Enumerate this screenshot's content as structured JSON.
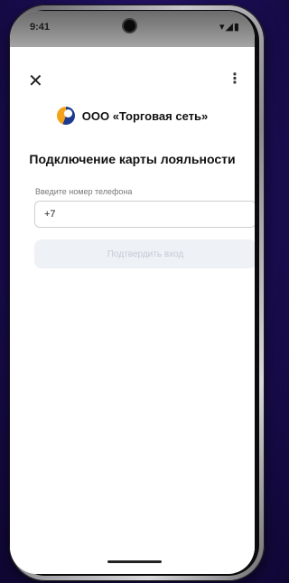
{
  "status_bar": {
    "time": "9:41",
    "icons": "▾◢▮"
  },
  "header": {
    "close_icon": "✕",
    "more_icon": "⋮"
  },
  "brand": {
    "name": "ООО «Торговая сеть»",
    "logo_colors": [
      "#1d3a8f",
      "#f3a21b"
    ]
  },
  "title": "Подключение карты лояльности",
  "form": {
    "phone_label": "Введите номер телефона",
    "phone_value": "+7",
    "confirm_button": "Подтвердить вход"
  },
  "colors": {
    "background": "#1f1060",
    "button_disabled_bg": "#eef1f6",
    "button_disabled_text": "#c4cad6"
  }
}
